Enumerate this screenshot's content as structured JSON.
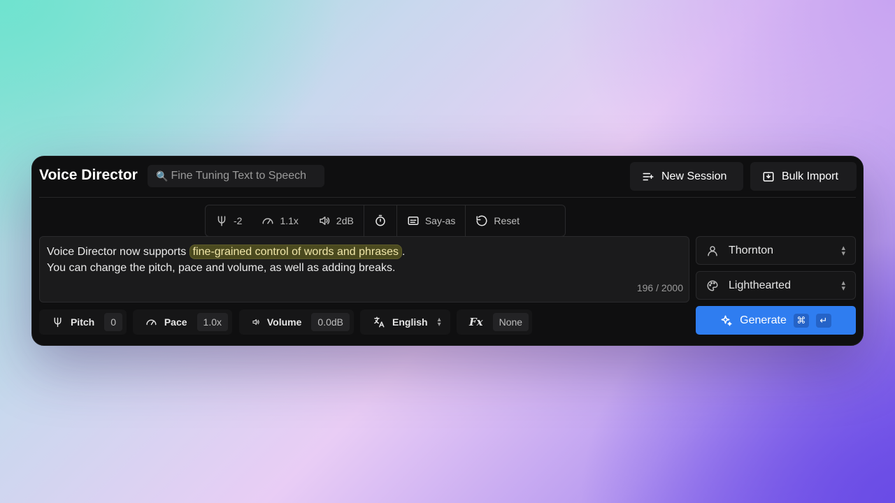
{
  "app": {
    "title": "Voice Director"
  },
  "search": {
    "label": "Fine Tuning Text to Speech"
  },
  "header": {
    "new_session": "New Session",
    "bulk_import": "Bulk Import"
  },
  "toolbar": {
    "pitch": "-2",
    "pace": "1.1x",
    "volume": "2dB",
    "say_as": "Say-as",
    "reset": "Reset"
  },
  "editor": {
    "line1_prefix": "Voice Director now supports",
    "highlighted": "fine-grained control of words and phrases",
    "line1_suffix": ".",
    "line2": "You can change the pitch, pace and volume, as well as adding breaks.",
    "char_count": "196 / 2000"
  },
  "voice": {
    "selected": "Thornton"
  },
  "tone": {
    "selected": "Lighthearted"
  },
  "generate": {
    "label": "Generate",
    "shortcut_cmd": "⌘",
    "shortcut_enter": "↵"
  },
  "controls": {
    "pitch": {
      "label": "Pitch",
      "value": "0"
    },
    "pace": {
      "label": "Pace",
      "value": "1.0x"
    },
    "volume": {
      "label": "Volume",
      "value": "0.0dB"
    },
    "language": {
      "label": "English"
    },
    "fx": {
      "label": "Fx",
      "value": "None"
    }
  },
  "colors": {
    "accent": "#2f7df0",
    "highlight_bg": "#4b4a1f",
    "panel_bg": "#0f0f10"
  }
}
